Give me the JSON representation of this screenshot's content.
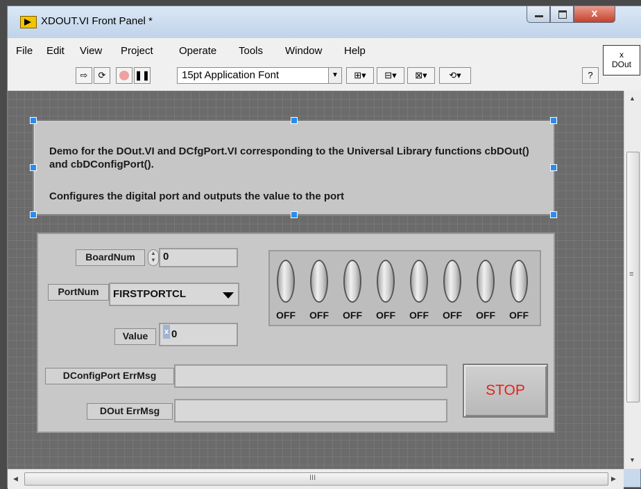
{
  "window": {
    "title": "XDOUT.VI Front Panel *",
    "close_label": "x"
  },
  "menu": {
    "items": [
      "File",
      "Edit",
      "View",
      "Project",
      "Operate",
      "Tools",
      "Window",
      "Help"
    ]
  },
  "toolbar": {
    "font_selector": "15pt Application Font",
    "help_label": "?"
  },
  "context_help": {
    "line1": "x",
    "line2": "DOut"
  },
  "description": {
    "line1": "Demo for the DOut.VI and DCfgPort.VI corresponding to the Universal Library functions  cbDOut() and cbDConfigPort().",
    "line2": "Configures the digital port and outputs the value to the port"
  },
  "controls": {
    "board_num_label": "BoardNum",
    "board_num_value": "0",
    "port_num_label": "PortNum",
    "port_num_value": "FIRSTPORTCL",
    "value_label": "Value",
    "value_radix": "x",
    "value_value": "0",
    "dconfig_err_label": "DConfigPort ErrMsg",
    "dconfig_err_value": "",
    "dout_err_label": "DOut ErrMsg",
    "dout_err_value": "",
    "stop_label": "STOP"
  },
  "switches": [
    "OFF",
    "OFF",
    "OFF",
    "OFF",
    "OFF",
    "OFF",
    "OFF",
    "OFF"
  ],
  "scroll": {
    "h_thumb_grip": "III",
    "v_thumb_grip": "≡"
  }
}
